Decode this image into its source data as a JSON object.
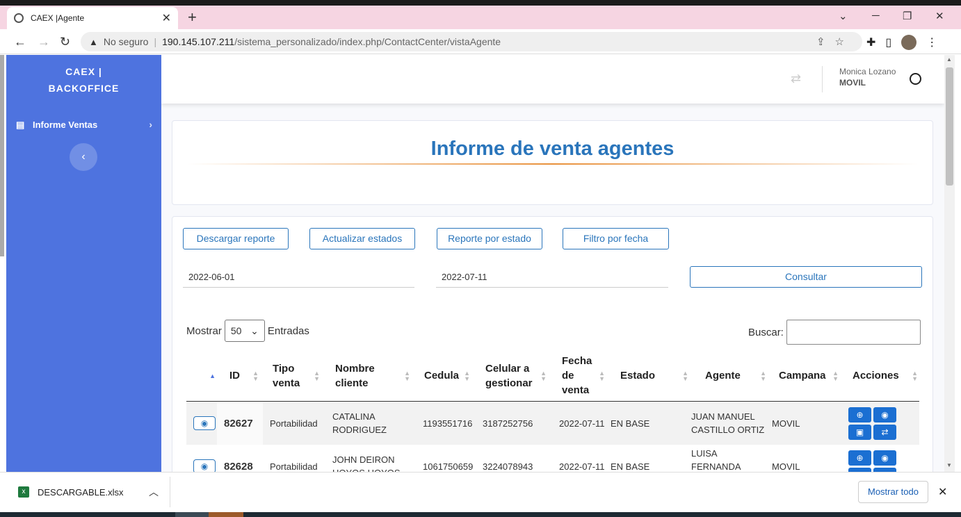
{
  "browser": {
    "tab_title": "CAEX |Agente",
    "security_label": "No seguro",
    "url_host": "190.145.107.211",
    "url_path": "/sistema_personalizado/index.php/ContactCenter/vistaAgente"
  },
  "sidebar": {
    "brand_line1": "CAEX |",
    "brand_line2": "BACKOFFICE",
    "items": [
      {
        "label": "Informe Ventas"
      }
    ]
  },
  "topbar": {
    "user_name": "Monica Lozano",
    "user_role": "MOVIL"
  },
  "page": {
    "title": "Informe de venta agentes"
  },
  "actions": {
    "download": "Descargar reporte",
    "update": "Actualizar estados",
    "by_state": "Reporte por estado",
    "by_date": "Filtro por fecha",
    "consult": "Consultar"
  },
  "filters": {
    "date_from": "2022-06-01",
    "date_to": "2022-07-11"
  },
  "table_controls": {
    "show_label": "Mostrar",
    "page_size": "50",
    "entries_label": "Entradas",
    "search_label": "Buscar:"
  },
  "table": {
    "headers": [
      "ID",
      "Tipo venta",
      "Nombre cliente",
      "Cedula",
      "Celular a gestionar",
      "Fecha de venta",
      "Estado",
      "Agente",
      "Campana",
      "Acciones"
    ],
    "rows": [
      {
        "id": "82627",
        "tipo": "Portabilidad",
        "nombre": "CATALINA RODRIGUEZ",
        "cedula": "1193551716",
        "celular": "3187252756",
        "fecha": "2022-07-11",
        "estado": "EN BASE",
        "agente": "JUAN MANUEL CASTILLO ORTIZ",
        "campana": "MOVIL"
      },
      {
        "id": "82628",
        "tipo": "Portabilidad",
        "nombre": "JOHN DEIRON HOYOS HOYOS",
        "cedula": "1061750659",
        "celular": "3224078943",
        "fecha": "2022-07-11",
        "estado": "EN BASE",
        "agente": "LUISA FERNANDA LOZANO",
        "campana": "MOVIL"
      }
    ]
  },
  "downloads": {
    "file_name": "DESCARGABLE.xlsx",
    "show_all": "Mostrar todo"
  },
  "colors": {
    "sidebar": "#4e73df",
    "accent": "#2a75bb",
    "action_button": "#1b6fd2"
  }
}
